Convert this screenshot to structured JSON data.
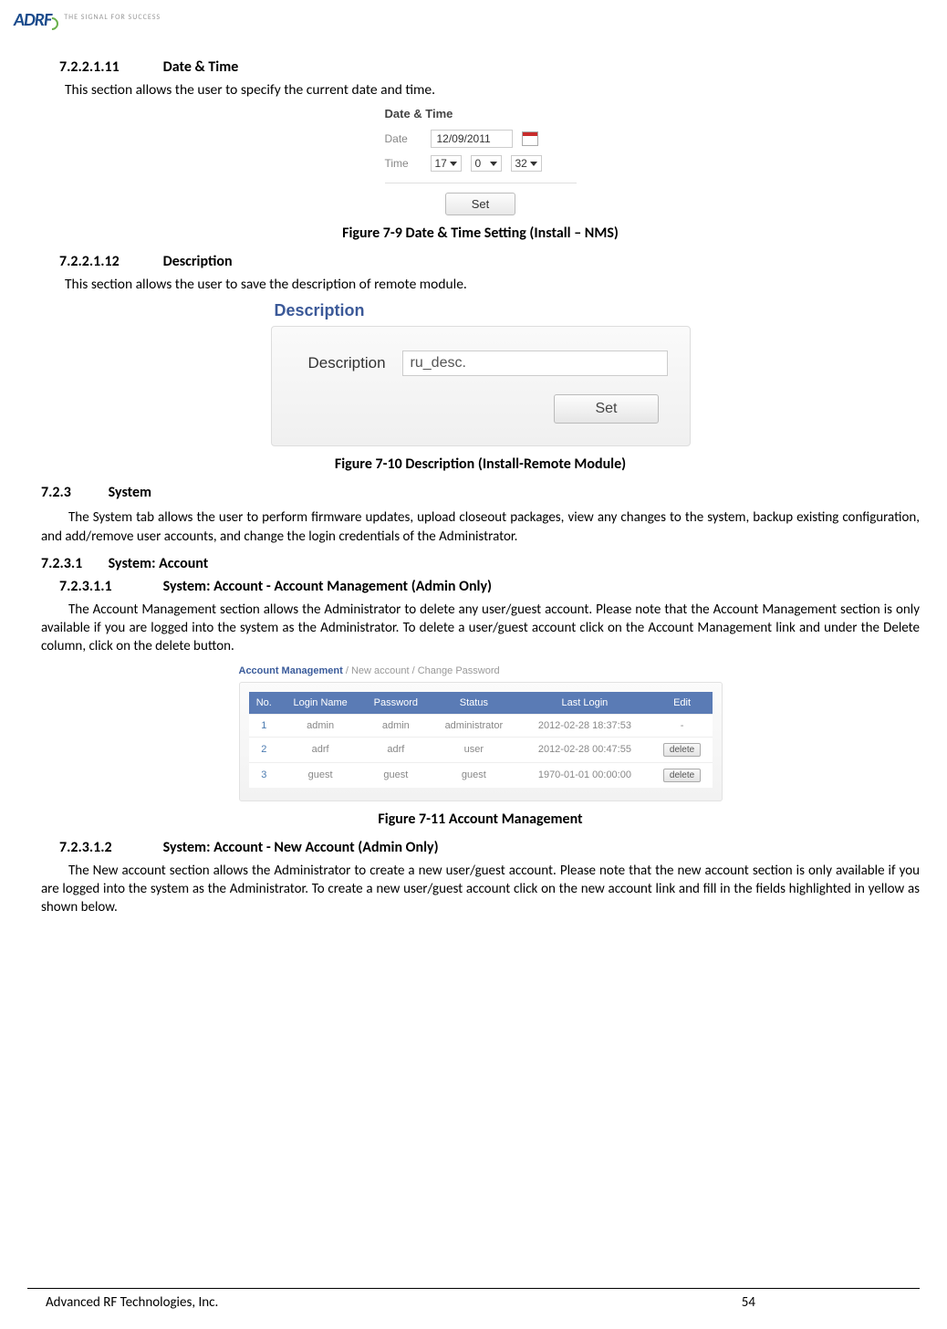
{
  "logo": {
    "brand": "ADRF",
    "tagline": "THE SIGNAL FOR SUCCESS"
  },
  "sec1": {
    "num": "7.2.2.1.11",
    "title": "Date & Time",
    "para": "This section allows the user to specify the current date and time."
  },
  "dt": {
    "heading": "Date & Time",
    "date_label": "Date",
    "date_value": "12/09/2011",
    "time_label": "Time",
    "hour": "17",
    "minute": "0",
    "second": "32",
    "set_label": "Set"
  },
  "fig1": "Figure 7-9     Date & Time Setting (Install – NMS)",
  "sec2": {
    "num": "7.2.2.1.12",
    "title": "Description",
    "para": "This section allows the user to save the description of remote module."
  },
  "desc": {
    "heading": "Description",
    "label": "Description",
    "value": "ru_desc.",
    "set_label": "Set"
  },
  "fig2": "Figure 7-10    Description (Install-Remote Module)",
  "sec3": {
    "num": "7.2.3",
    "title": "System",
    "para": "The System tab allows the user to perform firmware updates, upload closeout packages, view any changes to the system, backup existing configuration, and add/remove user accounts, and change the login credentials of the Administrator."
  },
  "sec4": {
    "num": "7.2.3.1",
    "title": "System: Account"
  },
  "sec5": {
    "num": "7.2.3.1.1",
    "title": "System: Account - Account Management (Admin Only)",
    "para": "The Account Management section allows the Administrator to delete any user/guest account.  Please note that the Account Management section is only available if you are logged into the system as the Administrator.  To delete a user/guest account click on the Account Management link and under the Delete column, click on the delete button."
  },
  "acct": {
    "breadcrumb": {
      "active": "Account Management",
      "sep": " / ",
      "b": "New account",
      "c": "Change Password"
    },
    "headers": [
      "No.",
      "Login Name",
      "Password",
      "Status",
      "Last Login",
      "Edit"
    ],
    "rows": [
      {
        "no": "1",
        "login": "admin",
        "pass": "admin",
        "status": "administrator",
        "last": "2012-02-28 18:37:53",
        "edit": "-"
      },
      {
        "no": "2",
        "login": "adrf",
        "pass": "adrf",
        "status": "user",
        "last": "2012-02-28 00:47:55",
        "edit": "delete"
      },
      {
        "no": "3",
        "login": "guest",
        "pass": "guest",
        "status": "guest",
        "last": "1970-01-01 00:00:00",
        "edit": "delete"
      }
    ]
  },
  "fig3": "Figure 7-11    Account Management",
  "sec6": {
    "num": "7.2.3.1.2",
    "title": "System: Account - New Account (Admin Only)",
    "para": "The New account section allows the Administrator to create a new user/guest account.  Please note that the new account section is only available if you are logged into the system as the Administrator.  To create a new user/guest account click on the new account link and fill in the fields highlighted in yellow as shown below."
  },
  "footer": {
    "company": "Advanced RF Technologies, Inc.",
    "page": "54"
  }
}
